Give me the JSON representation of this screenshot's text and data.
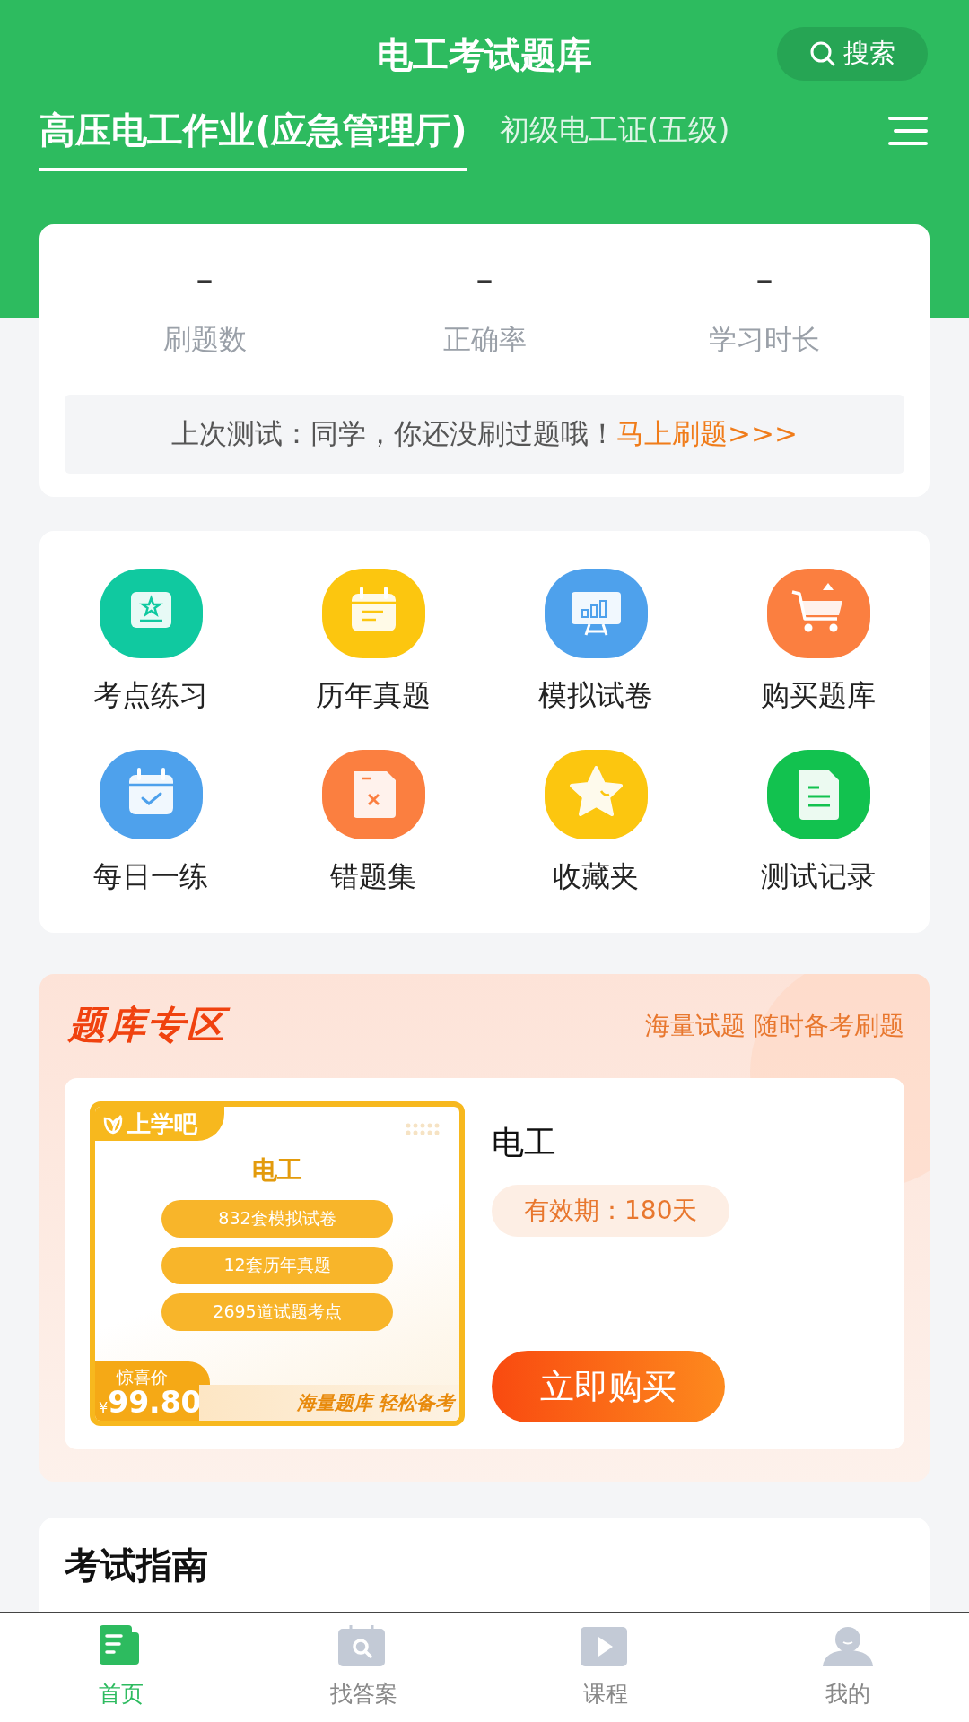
{
  "header": {
    "title": "电工考试题库",
    "search_label": "搜索"
  },
  "tabs": [
    {
      "label": "高压电工作业(应急管理厅)",
      "selected": true
    },
    {
      "label": "初级电工证(五级)",
      "selected": false
    }
  ],
  "stats": [
    {
      "value": "–",
      "label": "刷题数"
    },
    {
      "value": "–",
      "label": "正确率"
    },
    {
      "value": "–",
      "label": "学习时长"
    }
  ],
  "last_test": {
    "text": "上次测试：同学，你还没刷过题哦！",
    "link": "马上刷题>>>"
  },
  "features": [
    {
      "label": "考点练习",
      "kind": "star-board",
      "color": "#10c9a0"
    },
    {
      "label": "历年真题",
      "kind": "calendar",
      "color": "#fcc60f"
    },
    {
      "label": "模拟试卷",
      "kind": "chart-board",
      "color": "#4ea1ec"
    },
    {
      "label": "购买题库",
      "kind": "cart",
      "color": "#fb7f40"
    },
    {
      "label": "每日一练",
      "kind": "calendar-check",
      "color": "#4ea1ec"
    },
    {
      "label": "错题集",
      "kind": "error-file",
      "color": "#fb7f40"
    },
    {
      "label": "收藏夹",
      "kind": "star",
      "color": "#fcc60f"
    },
    {
      "label": "测试记录",
      "kind": "document",
      "color": "#12c24f"
    }
  ],
  "promo": {
    "title": "题库专区",
    "tagline": "海量试题 随时备考刷题",
    "product": {
      "cover": {
        "brand": "上学吧",
        "subject": "电工",
        "features": [
          "832套模拟试卷",
          "12套历年真题",
          "2695道试题考点"
        ],
        "price_label": "惊喜价",
        "currency": "¥",
        "price": "99.80",
        "slogan": "海量题库 轻松备考"
      },
      "title": "电工",
      "validity": "有效期：180天",
      "buy_label": "立即购买"
    }
  },
  "guide": {
    "title": "考试指南"
  },
  "nav": [
    {
      "label": "首页",
      "kind": "home-doc",
      "selected": true
    },
    {
      "label": "找答案",
      "kind": "search",
      "selected": false
    },
    {
      "label": "课程",
      "kind": "play",
      "selected": false
    },
    {
      "label": "我的",
      "kind": "person",
      "selected": false
    }
  ]
}
